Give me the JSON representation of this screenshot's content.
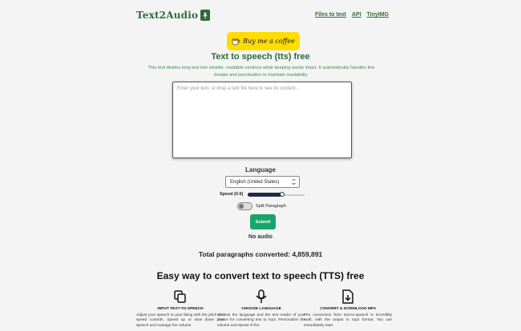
{
  "header": {
    "logo_text": "Text2Audio",
    "logo_icon": "microphone-icon",
    "nav": [
      {
        "label": "Files to text"
      },
      {
        "label": "API"
      },
      {
        "label": "TinyIMG"
      }
    ]
  },
  "coffee_button": {
    "label": "Buy me a coffee",
    "icon": "coffee-cup-icon",
    "color": "#ffdd00"
  },
  "main": {
    "title": "Text to speech (tts) free",
    "description": "This tool divides long text into smaller, readable sections while keeping words intact. It automatically handles line breaks and punctuation to maintain readability.",
    "textarea_placeholder": "Enter your text, or drop a text file here to see its content...",
    "language_label": "Language",
    "language_selected": "English (United States)",
    "speed_label": "Speed (0.6)",
    "speed_value": 0.6,
    "split_label": "Split Paragraph",
    "split_enabled": false,
    "submit_label": "Submit",
    "status": "No audio",
    "total_converted": "Total paragraphs converted: 4,859,891"
  },
  "features": {
    "heading": "Easy way to convert text to speech (TTS) free",
    "items": [
      {
        "icon": "copy-icon",
        "title": "INPUT TEXT-TO-SPEECH",
        "desc": "Adjust your speech to your liking with the pitch and speed controls. Speed up or slow down your speech and manage the volume"
      },
      {
        "icon": "microphone-icon",
        "title": "CHOOSE LANGUAGE",
        "desc": "Choose the language and the text reader of your choice for converting text to mp3. Personalize the volume and speed of the"
      },
      {
        "icon": "file-download-icon",
        "title": "CONVERT & DOWNLOAD MP3",
        "desc": "The conversion from text-to-speech is incredibly swift, with the output in mp3 format. You can immediately start"
      }
    ]
  },
  "colors": {
    "brand_green": "#2f6b3a",
    "submit_green": "#1aa568",
    "slider_dark": "#1f2a44"
  }
}
